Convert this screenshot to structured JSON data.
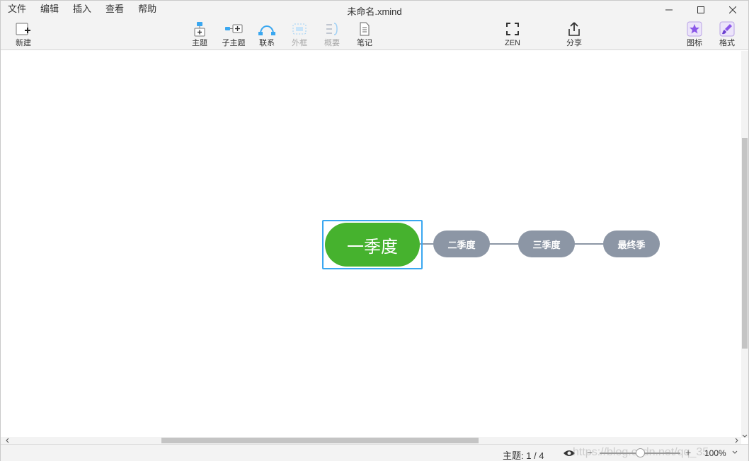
{
  "window": {
    "title": "未命名.xmind"
  },
  "menu": {
    "items": [
      "文件",
      "编辑",
      "插入",
      "查看",
      "帮助"
    ]
  },
  "toolbar": {
    "new_label": "新建",
    "topic_label": "主题",
    "subtopic_label": "子主题",
    "relationship_label": "联系",
    "boundary_label": "外框",
    "summary_label": "概要",
    "notes_label": "笔记",
    "zen_label": "ZEN",
    "share_label": "分享",
    "icon_label": "图标",
    "format_label": "格式"
  },
  "mindmap": {
    "central_topic": "一季度",
    "subtopics": [
      "二季度",
      "三季度",
      "最终季"
    ],
    "colors": {
      "central_fill": "#46b22e",
      "selection_frame": "#3aa7f0",
      "subtopic_fill": "#8c96a5",
      "connector": "#8c96a5"
    }
  },
  "status": {
    "topic_count": "主题: 1 / 4",
    "zoom_minus": "−",
    "zoom_plus": "+",
    "zoom_level": "100%",
    "watermark": "https://blog.csdn.net/qq_35..."
  },
  "icons": {
    "new": "new-document-icon",
    "topic": "topic-icon",
    "subtopic": "subtopic-icon",
    "relationship": "relationship-icon",
    "boundary": "boundary-icon",
    "summary": "summary-icon",
    "notes": "notes-icon",
    "zen": "fullscreen-icon",
    "share": "share-icon",
    "marker": "star-icon",
    "format": "paintbrush-icon",
    "visibility": "eye-icon"
  }
}
